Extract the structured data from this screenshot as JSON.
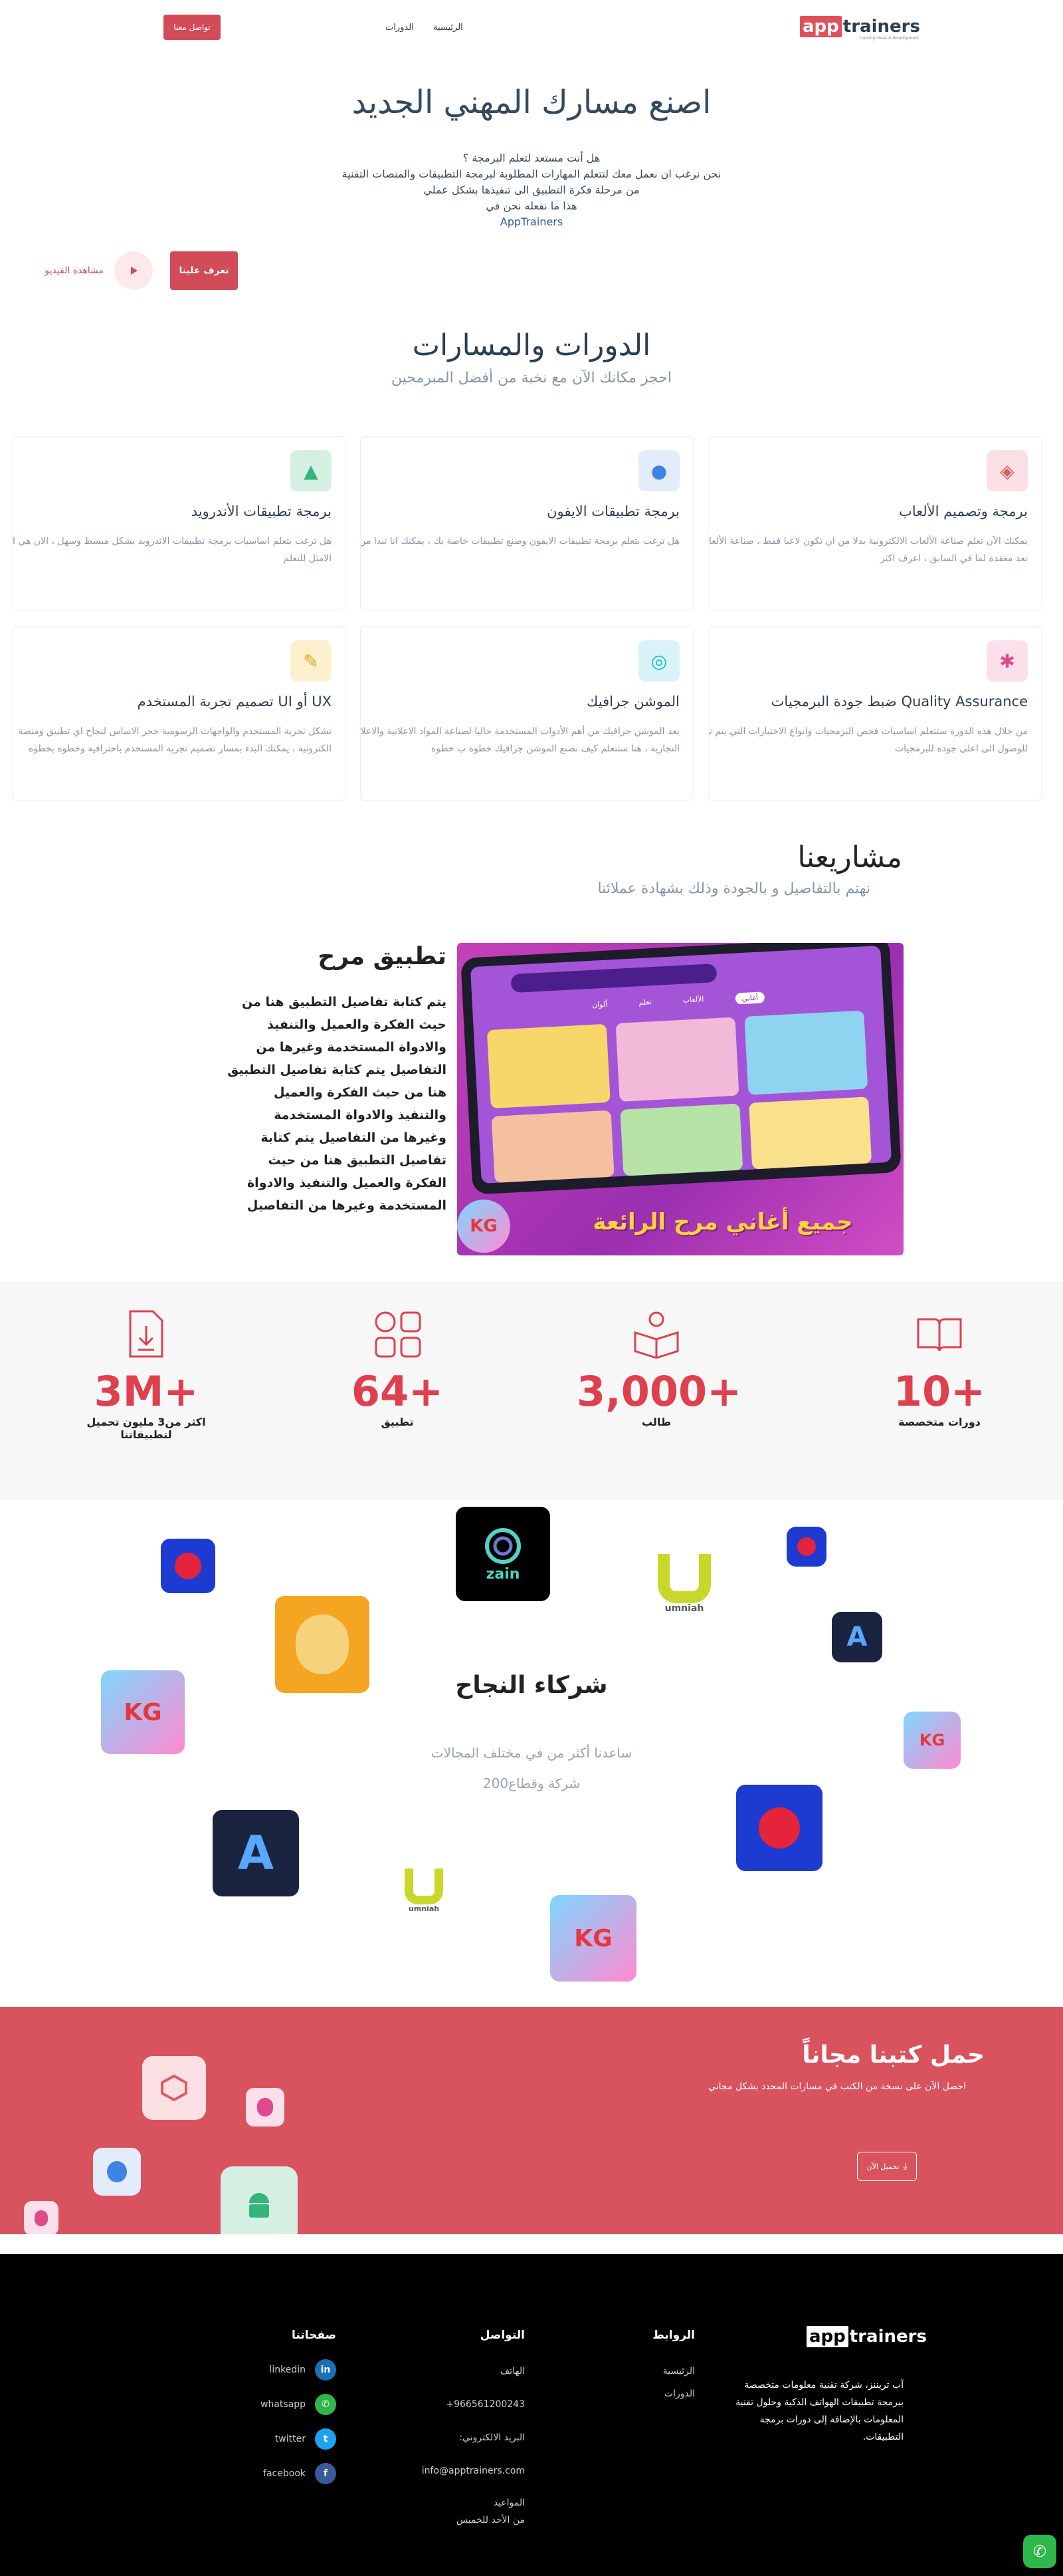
{
  "header": {
    "logo_app": "app",
    "logo_trainers": "trainers",
    "logo_sub": "training ideas & development",
    "nav_home": "الرئيسية",
    "nav_courses": "الدورات",
    "contact_button": "تواصل معنا"
  },
  "hero": {
    "title": "اصنع مسارك المهني الجديد",
    "lines": [
      "هل أنت مستعد لتعلم البرمجة ؟",
      "نحن نرغب ان نعمل معك لتتعلم المهارات المطلوبة لبرمجة التطبيقات والمنصات التقنية",
      "من مرحلة فكرة التطبيق الى تنفيذها بشكل عملي",
      "هذا ما نفعله نحن في"
    ],
    "brand": "AppTrainers",
    "learn_button": "تعرف علينا",
    "video_label": "مشاهدة الفيديو"
  },
  "courses": {
    "title": "الدورات والمسارات",
    "subtitle": "احجز مكانك الآن مع نخبة من أفضل المبرمجين",
    "items": [
      {
        "title": "برمجة وتصميم الألعاب",
        "desc": "يمكنك الآن تعلم صناعة الألعاب الالكترونية بدلا من ان تكون لاعبا فقط ، صناعة الألعاب لم تعد معقدة لما في السابق ، اعرف اكثر",
        "icon": "unity-icon"
      },
      {
        "title": "برمجة تطبيقات الايفون",
        "desc": "هل ترغب بتعلم برمجة تطبيقات الايفون وصنع تطبيقات خاصة بك ، يمكنك انا تبدا من هنا",
        "icon": "apple-icon"
      },
      {
        "title": "برمجة تطبيقات الأندرويد",
        "desc": "هل ترغب بتعلم اساسيات برمجة تطبيقات الاندرويد بشكل مبسط وسهل ، الان هي الفرصة الامثل للتعلم",
        "icon": "android-icon"
      },
      {
        "title": "Quality Assurance ضبط جودة البرمجيات",
        "desc": "من خلال هذه الدورة ستتعلم اساسيات فحص البرمجيات وانواع الاختبارات التي يتم تطبيقها للوصول الى اعلى جودة للبرمجيات",
        "icon": "bug-icon"
      },
      {
        "title": "الموشن جرافيك",
        "desc": "يعد الموشن جرافيك من أهم الأدوات المستخدمة حاليا لصناعة المواد الاعلانية والاعلانات التجارية ، هنا ستتعلم كيف نصنع الموشن جرافيك خطوة ب خطوة",
        "icon": "motion-icon"
      },
      {
        "title": "UX أو UI تصميم تجربة المستخدم",
        "desc": "تشكل تجربة المستخدم والواجهات الرسومية حجر الاساس لنجاح اي تطبيق ومنصة الكترونية ، يمكنك البدء بمسار تصميم تجربة المستخدم باحترافية وخطوة بخطوة",
        "icon": "pencil-icon"
      }
    ]
  },
  "projects": {
    "title": "مشاريعنا",
    "subtitle": "نهتم بالتفاصيل و بالجودة وذلك بشهادة عملائنا",
    "project_title": "تطبيق مرح",
    "project_desc": "يتم كتابة تفاصيل التطبيق هنا من حيث الفكرة والعميل والتنفيذ والادواة المستخدمة وغيرها من التفاصيل يتم كتابة تفاصيل التطبيق هنا من حيث الفكرة والعميل والتنفيذ والادواة المستخدمة وغيرها من التفاصيل يتم كتابة تفاصيل التطبيق هنا من حيث الفكرة والعميل والتنفيذ والادواة المستخدمة وغيرها من التفاصيل",
    "image_tabs": [
      "أغاني",
      "الألعاب",
      "تعلم",
      "ألوان"
    ],
    "image_banner": "جميع أغاني مرح الرائعة"
  },
  "stats": [
    {
      "number": "10+",
      "label": "دورات متخصصة",
      "icon": "book-icon"
    },
    {
      "number": "3,000+",
      "label": "طالب",
      "icon": "student-icon"
    },
    {
      "number": "64+",
      "label": "تطبيق",
      "icon": "apps-icon"
    },
    {
      "number": "3M+",
      "label": "اكثر من3 مليون تحميل لتطبيقاتنا",
      "icon": "download-icon"
    }
  ],
  "partners": {
    "title": "شركاء النجاح",
    "line1": "ساعدنا أكثر من في مختلف المجالات",
    "line2": "شركة وقطاع200",
    "zain": "zain",
    "umniah": "umniah",
    "kg": "KG"
  },
  "books": {
    "title": "حمل كتبنا مجاناً",
    "subtitle": "احصل الآن على نسخة من الكتب في مسارات المحدد بشكل مجاني",
    "button": "تحميل الآن"
  },
  "footer": {
    "about": "آب تريننز، شركة تقنية معلومات متخصصة ببرمجة تطبيقات الهواتف الذكية وحلول تقنية المعلومات بالإضافة إلى دورات برمجة التطبيقات.",
    "links_title": "الروابط",
    "links": [
      "الرئيسية",
      "الدورات"
    ],
    "contact_title": "التواصل",
    "phone_label": "الهاتف",
    "phone": "+966561200243",
    "email_label": "البريد الالكتروني:",
    "email": "info@apptrainers.com",
    "hours_label": "المواعيد",
    "hours": "من الأحد للخميس",
    "pages_title": "صفحاتنا",
    "social": [
      {
        "name": "linkedin",
        "color": "#1b6fb5",
        "glyph": "in"
      },
      {
        "name": "whatsapp",
        "color": "#2fb84a",
        "glyph": "✆"
      },
      {
        "name": "twitter",
        "color": "#1da1f2",
        "glyph": "t"
      },
      {
        "name": "facebook",
        "color": "#3b5998",
        "glyph": "f"
      }
    ]
  },
  "colors": {
    "accent": "#d14b58",
    "stat": "#e0404e",
    "footer_bg": "#000000",
    "books_bg": "#d9535f"
  }
}
